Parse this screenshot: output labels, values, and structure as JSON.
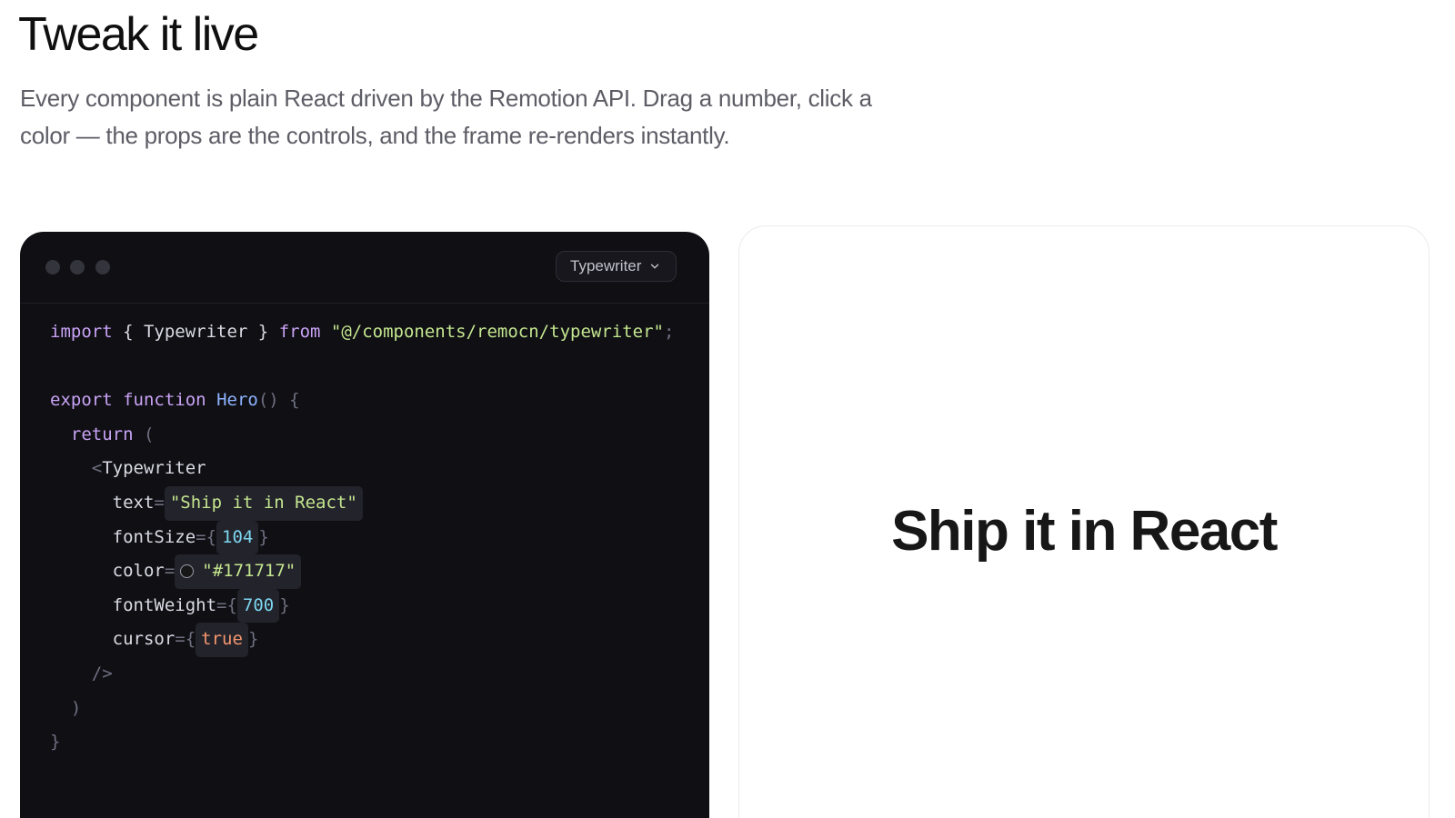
{
  "header": {
    "title": "Tweak it live",
    "lede": "Every component is plain React driven by the Remotion API. Drag a number, click a color — the props are the controls, and the frame re-renders instantly."
  },
  "code_panel": {
    "component_select": {
      "value": "Typewriter"
    },
    "code": {
      "import_kw": "import",
      "import_open": " { ",
      "import_name": "Typewriter",
      "import_close": " } ",
      "from_kw": "from",
      "import_path": "\"@/components/remocn/typewriter\"",
      "semicolon": ";",
      "export_kw": "export",
      "function_kw": "function",
      "fn_name": "Hero",
      "fn_parens": "() {",
      "return_kw": "return",
      "return_paren": " (",
      "lt": "<",
      "tag_name": "Typewriter",
      "props": {
        "text_name": "text",
        "text_value": "\"Ship it in React\"",
        "fontSize_name": "fontSize",
        "fontSize_value": "104",
        "color_name": "color",
        "color_value": "\"#171717\"",
        "fontWeight_name": "fontWeight",
        "fontWeight_value": "700",
        "cursor_name": "cursor",
        "cursor_value": "true"
      },
      "eq": "=",
      "eq_brace": "={",
      "brace_close": "}",
      "self_close": "/>",
      "paren_close": ")",
      "fn_close": "}"
    }
  },
  "preview": {
    "text": "Ship it in React"
  },
  "colors": {
    "code_bg": "#0f0f14",
    "keyword": "#c9a3f5",
    "function": "#8eb3ff",
    "string": "#c4e68f",
    "number": "#7dd6f0",
    "boolean": "#f5966e",
    "preview_text": "#171717"
  },
  "icons": {
    "select": "chevron-down-icon",
    "color_control": "color-swatch-icon"
  }
}
